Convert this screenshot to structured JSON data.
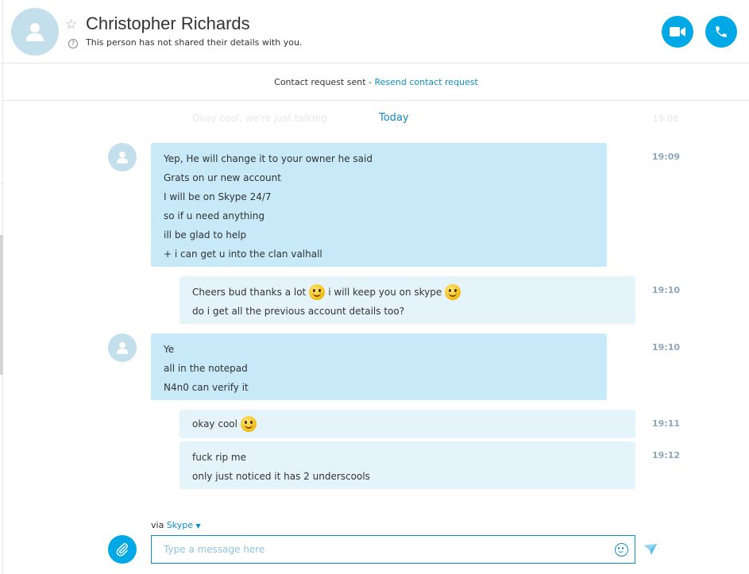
{
  "header": {
    "contact_name": "Christopher Richards",
    "status_text": "This person has not shared their details with you.",
    "favorite_icon": "star-icon",
    "info_icon": "question-icon",
    "video_icon": "video-camera-icon",
    "call_icon": "phone-icon",
    "accent_color": "#00a8e6"
  },
  "request_bar": {
    "prefix": "Contact request sent - ",
    "link": "Resend contact request"
  },
  "history": {
    "faded_text": "Okay cool, we're just talking",
    "day_label": "Today"
  },
  "messages": [
    {
      "direction": "incoming",
      "time": "19:09",
      "lines": [
        "Yep, He will change it to your owner he said",
        "Grats on ur new account",
        "I will be on Skype 24/7",
        "so if u need anything",
        "ill be glad to help",
        "+ i can get u into the clan valhall"
      ]
    },
    {
      "direction": "outgoing",
      "time": "19:10",
      "lines": [
        "Cheers bud thanks a lot",
        "i will keep you on skype",
        "do i get all the previous account details too?"
      ]
    },
    {
      "direction": "incoming",
      "time": "19:10",
      "lines": [
        "Ye",
        "all in the notepad",
        "N4n0 can verify it"
      ]
    },
    {
      "direction": "outgoing",
      "time": "19:11",
      "lines": [
        "okay cool"
      ]
    },
    {
      "direction": "outgoing",
      "time": "19:12",
      "lines": [
        "fuck rip me",
        "only just noticed it has 2 underscools"
      ]
    }
  ],
  "compose": {
    "via_label": "via",
    "service": "Skype",
    "placeholder": "Type a message here",
    "attach_icon": "paperclip-icon",
    "emoji_icon": "emoticon-icon",
    "send_icon": "send-icon"
  },
  "colors": {
    "incoming_bubble": "#c7e9f8",
    "outgoing_bubble": "#e5f4fb",
    "link": "#0d8fc3",
    "timestamp": "#8aa8bc"
  }
}
